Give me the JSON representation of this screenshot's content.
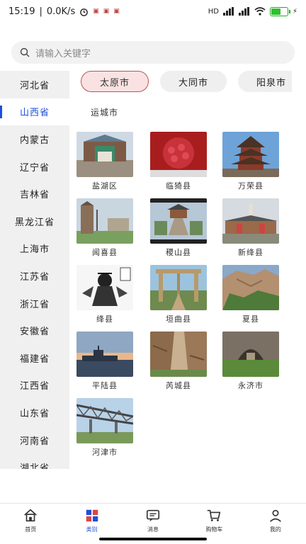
{
  "status": {
    "time": "15:19",
    "speed": "0.0K/s",
    "network": "HD",
    "battery_level": 0.6
  },
  "search": {
    "placeholder": "请输入关键字"
  },
  "sidebar": {
    "items": [
      {
        "label": "河北省"
      },
      {
        "label": "山西省",
        "active": true
      },
      {
        "label": "内蒙古"
      },
      {
        "label": "辽宁省"
      },
      {
        "label": "吉林省"
      },
      {
        "label": "黑龙江省"
      },
      {
        "label": "上海市"
      },
      {
        "label": "江苏省"
      },
      {
        "label": "浙江省"
      },
      {
        "label": "安徽省"
      },
      {
        "label": "福建省"
      },
      {
        "label": "江西省"
      },
      {
        "label": "山东省"
      },
      {
        "label": "河南省"
      },
      {
        "label": "湖北省"
      }
    ]
  },
  "city_tabs": [
    {
      "label": "太原市",
      "active": true
    },
    {
      "label": "大同市"
    },
    {
      "label": "阳泉市"
    }
  ],
  "subtitle": "运城市",
  "places": [
    {
      "label": "盐湖区",
      "icon": "gate-photo"
    },
    {
      "label": "临猗县",
      "icon": "pomegranate-photo"
    },
    {
      "label": "万荣县",
      "icon": "tower-photo"
    },
    {
      "label": "闻喜县",
      "icon": "ruin-photo"
    },
    {
      "label": "稷山县",
      "icon": "temple-photo"
    },
    {
      "label": "新绛县",
      "icon": "pagoda-photo"
    },
    {
      "label": "绛县",
      "icon": "ink-painting-photo"
    },
    {
      "label": "垣曲县",
      "icon": "archway-photo"
    },
    {
      "label": "夏县",
      "icon": "cliff-photo"
    },
    {
      "label": "平陆县",
      "icon": "harbor-photo"
    },
    {
      "label": "芮城县",
      "icon": "canyon-photo"
    },
    {
      "label": "永济市",
      "icon": "cave-photo"
    },
    {
      "label": "河津市",
      "icon": "bridge-photo"
    }
  ],
  "tabbar": [
    {
      "label": "首页",
      "icon": "home-icon"
    },
    {
      "label": "类别",
      "icon": "category-icon",
      "active": true
    },
    {
      "label": "消息",
      "icon": "message-icon"
    },
    {
      "label": "购物车",
      "icon": "cart-icon"
    },
    {
      "label": "我的",
      "icon": "profile-icon"
    }
  ],
  "colors": {
    "accent": "#1f4fd8",
    "tab_active_bg": "#fbe2e2",
    "sidebar_bg": "#f0f0f0"
  }
}
